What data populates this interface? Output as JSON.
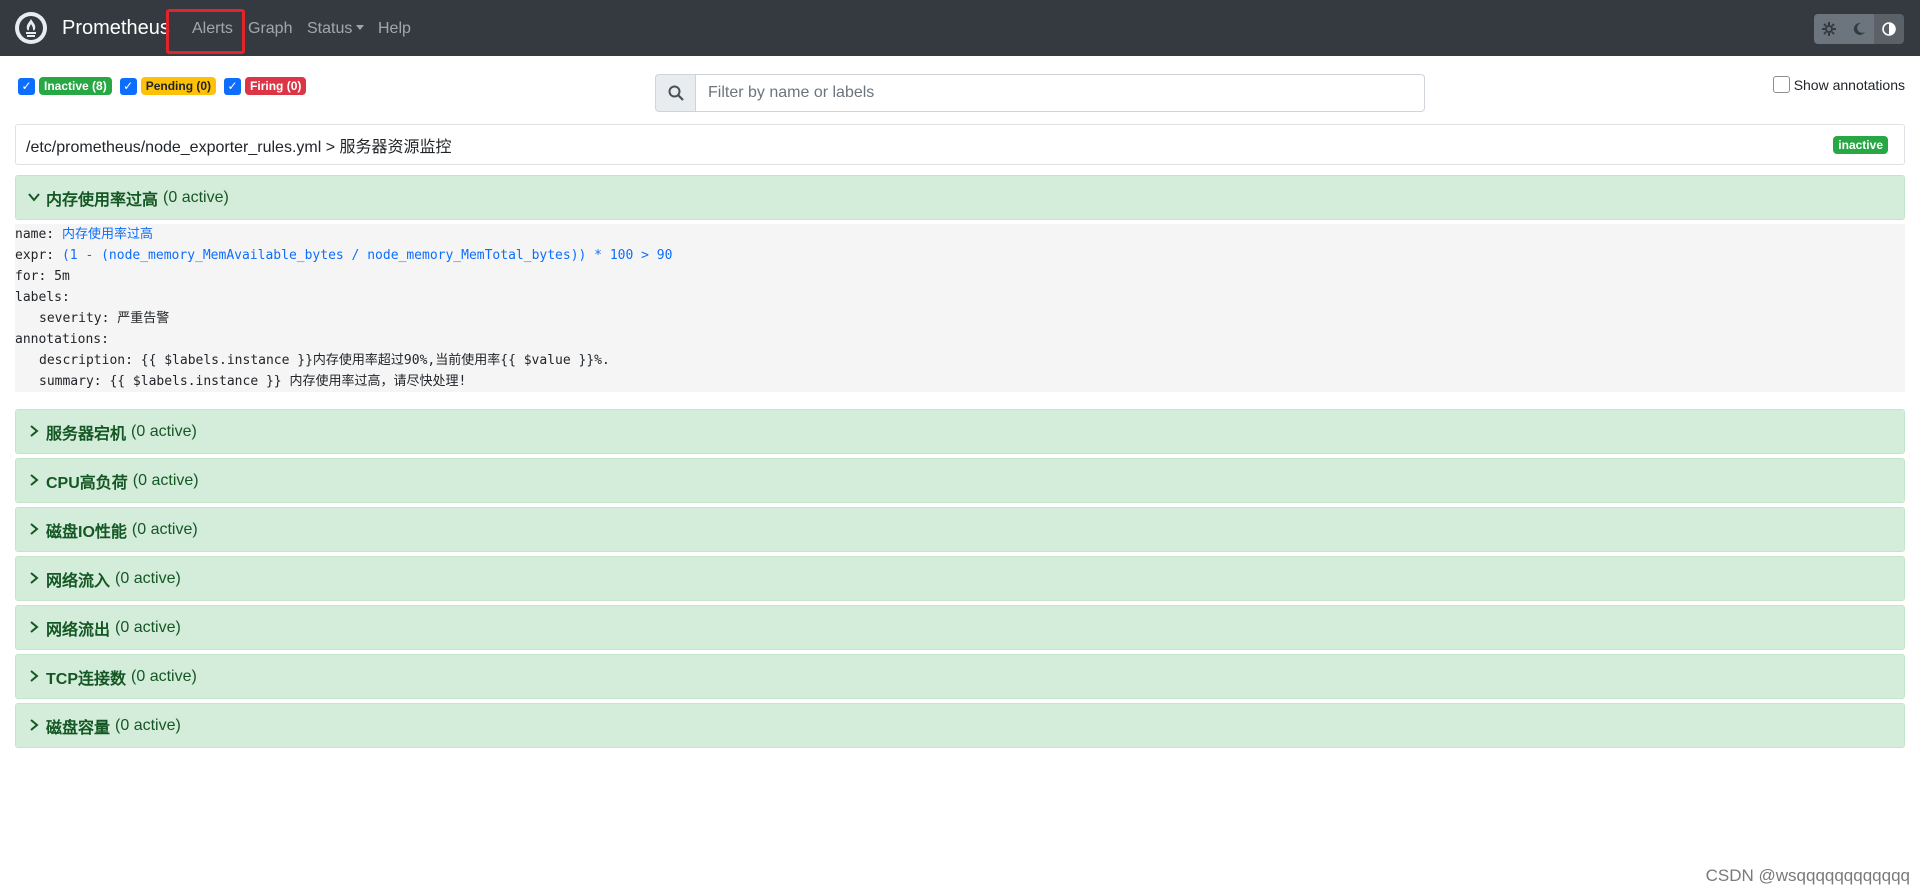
{
  "navbar": {
    "brand": "Prometheus",
    "items": [
      {
        "label": "Alerts"
      },
      {
        "label": "Graph"
      },
      {
        "label": "Status"
      },
      {
        "label": "Help"
      }
    ],
    "theme_buttons": [
      "gear-icon",
      "moon-icon",
      "contrast-icon"
    ]
  },
  "filters": {
    "inactive": "Inactive (8)",
    "pending": "Pending (0)",
    "firing": "Firing (0)",
    "search_placeholder": "Filter by name or labels",
    "show_annotations": "Show annotations"
  },
  "group": {
    "path": "/etc/prometheus/node_exporter_rules.yml > 服务器资源监控",
    "state": "inactive"
  },
  "expanded_rule": {
    "name_key": "name:",
    "name_value": "内存使用率过高",
    "expr_key": "expr:",
    "expr_value": "(1 - (node_memory_MemAvailable_bytes / node_memory_MemTotal_bytes)) * 100 > 90",
    "for_line": "for: 5m",
    "labels_key": "labels:",
    "severity_line": "severity: 严重告警",
    "annotations_key": "annotations:",
    "description_line": "description: {{ $labels.instance }}内存使用率超过90%,当前使用率{{ $value }}%.",
    "summary_line": "summary: {{ $labels.instance }} 内存使用率过高，请尽快处理!"
  },
  "rules": [
    {
      "name": "内存使用率过高",
      "count": "(0 active)",
      "expanded": true
    },
    {
      "name": "服务器宕机",
      "count": "(0 active)"
    },
    {
      "name": "CPU高负荷",
      "count": "(0 active)"
    },
    {
      "name": "磁盘IO性能",
      "count": "(0 active)"
    },
    {
      "name": "网络流入",
      "count": "(0 active)"
    },
    {
      "name": "网络流出",
      "count": "(0 active)"
    },
    {
      "name": "TCP连接数",
      "count": "(0 active)"
    },
    {
      "name": "磁盘容量",
      "count": "(0 active)"
    }
  ],
  "watermark": "CSDN @wsqqqqqqqqqqqq",
  "colors": {
    "navbar": "#343a40",
    "highlight": "#e3242b",
    "alert_bg": "#d4edda",
    "alert_text": "#155724",
    "inactive": "#28a745",
    "pending": "#ffc107",
    "firing": "#dc3545"
  }
}
